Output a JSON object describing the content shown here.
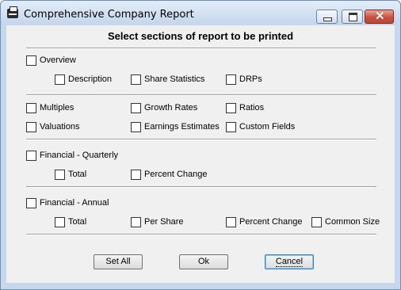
{
  "window": {
    "title": "Comprehensive Company Report"
  },
  "dialog": {
    "heading": "Select sections of report to be printed"
  },
  "sections": {
    "overview": "Overview",
    "description": "Description",
    "share_statistics": "Share Statistics",
    "drps": "DRPs",
    "multiples": "Multiples",
    "growth_rates": "Growth Rates",
    "ratios": "Ratios",
    "valuations": "Valuations",
    "earnings_estimates": "Earnings Estimates",
    "custom_fields": "Custom Fields",
    "financial_quarterly": "Financial - Quarterly",
    "quarterly_total": "Total",
    "quarterly_percent_change": "Percent Change",
    "financial_annual": "Financial - Annual",
    "annual_total": "Total",
    "annual_per_share": "Per Share",
    "annual_percent_change": "Percent Change",
    "annual_common_size": "Common Size"
  },
  "buttons": {
    "set_all": "Set All",
    "ok": "Ok",
    "cancel": "Cancel"
  },
  "icons": {
    "app": "printer-icon",
    "minimize": "minimize-icon",
    "maximize": "maximize-icon",
    "close": "close-icon"
  },
  "colors": {
    "close_button": "#c7503e",
    "dialog_bg": "#f0f0f0",
    "frame": "#c7d8ec"
  }
}
